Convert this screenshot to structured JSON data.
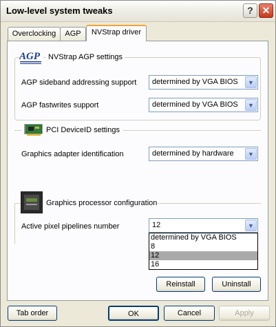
{
  "window": {
    "title": "Low-level system tweaks"
  },
  "title_buttons": {
    "help": "?",
    "close": "✕"
  },
  "tabs": [
    {
      "label": "Overclocking"
    },
    {
      "label": "AGP"
    },
    {
      "label": "NVStrap driver"
    }
  ],
  "agp_group": {
    "logo_text": "AGP",
    "title": "NVStrap AGP settings",
    "sideband_label": "AGP sideband addressing support",
    "sideband_value": "determined by VGA BIOS",
    "fastwrites_label": "AGP fastwrites support",
    "fastwrites_value": "determined by VGA BIOS"
  },
  "pci_group": {
    "title": "PCI DeviceID settings",
    "adapter_label": "Graphics adapter identification",
    "adapter_value": "determined by hardware"
  },
  "gpu_group": {
    "title": "Graphics processor configuration",
    "pipelines_label": "Active pixel pipelines number",
    "pipelines_value": "12",
    "pipelines_options": [
      "determined by VGA BIOS",
      "8",
      "12",
      "16"
    ]
  },
  "panel_buttons": {
    "reinstall": "Reinstall",
    "uninstall": "Uninstall"
  },
  "footer": {
    "tab_order": "Tab order",
    "ok": "OK",
    "cancel": "Cancel",
    "apply": "Apply"
  },
  "icons": {
    "combo_arrow": "chevron-down-icon",
    "agp_logo": "agp-logo-icon",
    "pci_card": "pci-card-icon",
    "gpu_chip": "gpu-chip-icon"
  },
  "colors": {
    "window_bg": "#ece9d8",
    "panel_bg": "#fcfcfe",
    "close_btn": "#c5391c",
    "tab_highlight": "#f1a433",
    "dropdown_selected": "#a9a9a9"
  }
}
